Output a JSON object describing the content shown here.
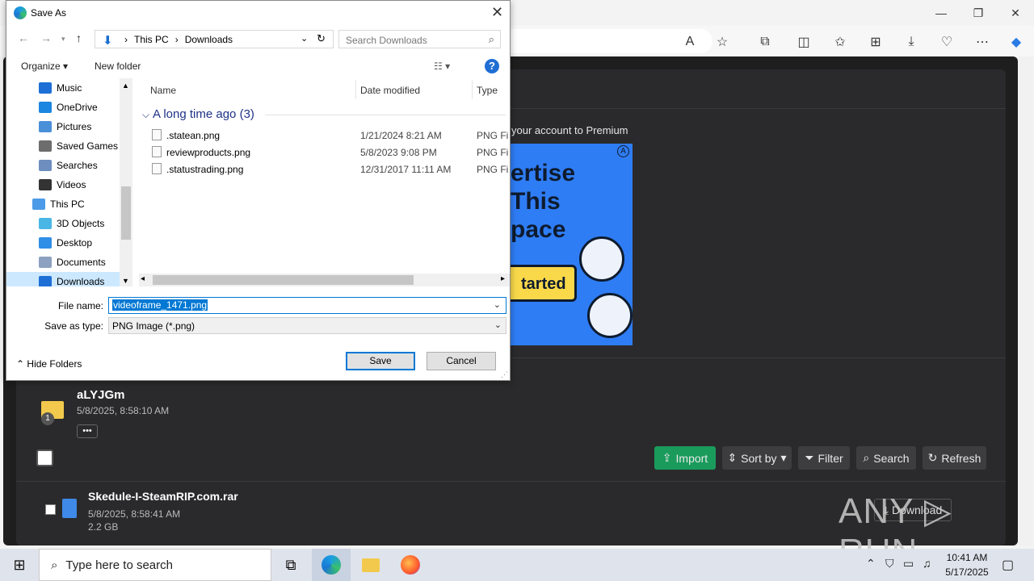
{
  "browser": {
    "window_controls": {
      "minimize": "—",
      "restore": "❐",
      "close": "✕"
    },
    "toolbar_icons": [
      "read-aloud-icon",
      "favorite-star-icon",
      "extensions-icon",
      "split-screen-icon",
      "favorites-icon",
      "collections-icon",
      "downloads-icon",
      "browser-essentials-icon",
      "more-icon",
      "copilot-icon"
    ]
  },
  "page": {
    "premium_text": "your account to Premium",
    "ad": {
      "line1": "ertise",
      "line2": "This",
      "line3": "pace",
      "button": "tarted"
    },
    "folder": {
      "badge": "1",
      "name": "aLYJGm",
      "date": "5/8/2025, 8:58:10 AM",
      "more": "•••"
    },
    "actions": {
      "import": "Import",
      "sort_by": "Sort by",
      "filter": "Filter",
      "search": "Search",
      "refresh": "Refresh"
    },
    "file": {
      "name": "Skedule-I-SteamRIP.com.rar",
      "date": "5/8/2025, 8:58:41 AM",
      "size": "2.2 GB",
      "download": "Download"
    },
    "watermark": "ANY ▷ RUN"
  },
  "dialog": {
    "title": "Save As",
    "breadcrumb": [
      "This PC",
      "Downloads"
    ],
    "search_placeholder": "Search Downloads",
    "organize": "Organize",
    "new_folder": "New folder",
    "help": "?",
    "tree": [
      {
        "label": "Music",
        "color": "#1d6fd6"
      },
      {
        "label": "OneDrive",
        "color": "#1a86e0"
      },
      {
        "label": "Pictures",
        "color": "#4a90d9"
      },
      {
        "label": "Saved Games",
        "color": "#6d6d6d"
      },
      {
        "label": "Searches",
        "color": "#6d8ebf"
      },
      {
        "label": "Videos",
        "color": "#333333"
      },
      {
        "label": "This PC",
        "color": "#4c9be8"
      },
      {
        "label": "3D Objects",
        "color": "#49b6e6"
      },
      {
        "label": "Desktop",
        "color": "#2f8ee6"
      },
      {
        "label": "Documents",
        "color": "#8ca0bf"
      },
      {
        "label": "Downloads",
        "color": "#1d6fd6"
      }
    ],
    "columns": {
      "name": "Name",
      "date": "Date modified",
      "type": "Type"
    },
    "group": "A long time ago (3)",
    "files": [
      {
        "name": ".statean.png",
        "date": "1/21/2024 8:21 AM",
        "type": "PNG File"
      },
      {
        "name": "reviewproducts.png",
        "date": "5/8/2023 9:08 PM",
        "type": "PNG File"
      },
      {
        "name": ".statustrading.png",
        "date": "12/31/2017 11:11 AM",
        "type": "PNG File"
      }
    ],
    "file_name_label": "File name:",
    "file_name_value": "videoframe_1471.png",
    "save_type_label": "Save as type:",
    "save_type_value": "PNG Image (*.png)",
    "hide_folders": "Hide Folders",
    "save": "Save",
    "cancel": "Cancel"
  },
  "taskbar": {
    "search_placeholder": "Type here to search",
    "time": "10:41 AM",
    "date": "5/17/2025"
  }
}
